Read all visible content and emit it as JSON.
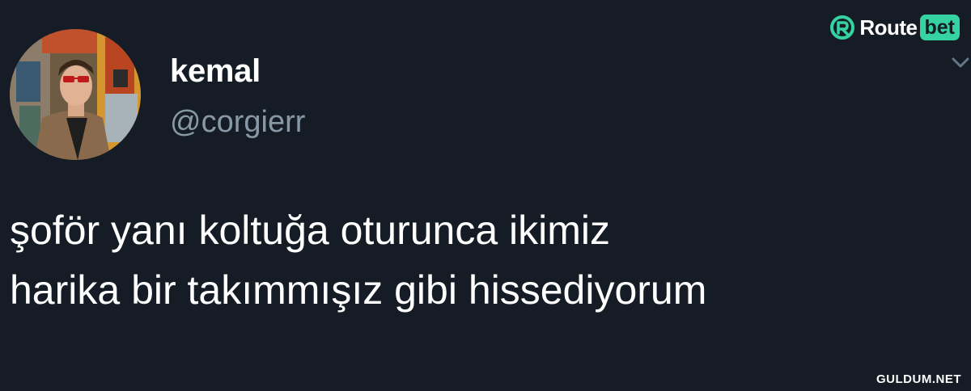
{
  "tweet": {
    "display_name": "kemal",
    "handle": "@corgierr",
    "text_lines": [
      "şoför yanı koltuğa oturunca ikimiz",
      "harika bir takımmışız gibi hissediyorum"
    ],
    "avatar_icon": "avatar",
    "menu_icon": "chevron-down-icon"
  },
  "branding": {
    "logo_word": "Route",
    "logo_badge": "bet",
    "accent_color": "#35d2a2",
    "watermark": "GULDUM.NET"
  },
  "colors": {
    "background": "#151c26",
    "text_primary": "#ffffff",
    "text_secondary": "#8899a6"
  }
}
